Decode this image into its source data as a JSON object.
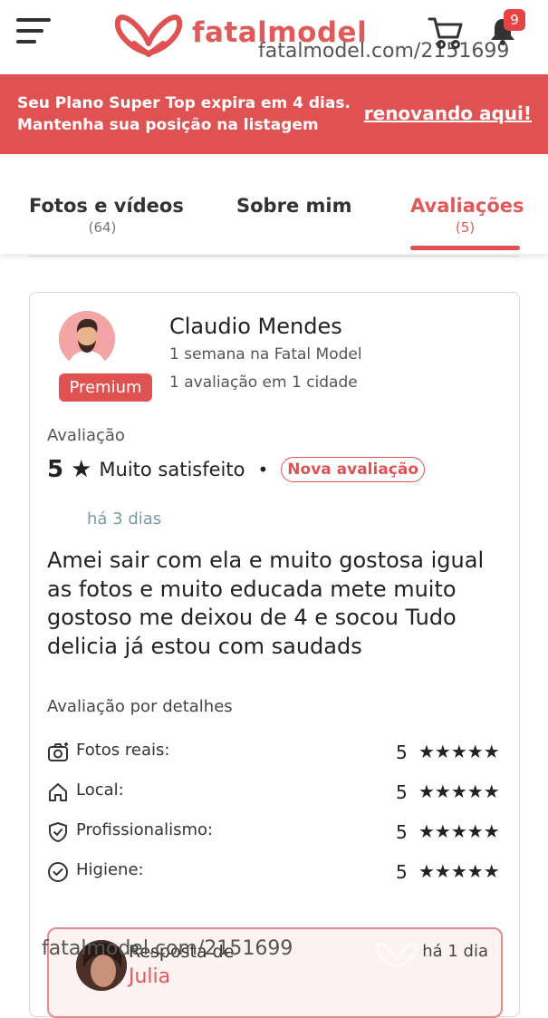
{
  "header": {
    "logo_text": "fatalmodel",
    "watermark": "fatalmodel.com/2151699",
    "notification_count": "9"
  },
  "banner": {
    "line1": "Seu Plano Super Top expira em 4 dias.",
    "line2": "Mantenha sua posição na listagem",
    "link": "renovando aqui!"
  },
  "tabs": [
    {
      "label": "Fotos e vídeos",
      "count": "(64)"
    },
    {
      "label": "Sobre mim",
      "count": ""
    },
    {
      "label": "Avaliações",
      "count": "(5)"
    }
  ],
  "review": {
    "reviewer_name": "Claudio Mendes",
    "reviewer_since": "1 semana na Fatal Model",
    "reviewer_reviews": "1 avaliação em 1 cidade",
    "badge": "Premium",
    "rating_label": "Avaliação",
    "rating_value": "5",
    "rating_text": "Muito satisfeito",
    "new_badge": "Nova avaliação",
    "time_ago": "há 3 dias",
    "text": "Amei sair com ela e muito gostosa igual as fotos e muito educada mete muito gostoso me deixou de 4 e socou Tudo delicia já estou com saudads",
    "details_label": "Avaliação por detalhes",
    "details": [
      {
        "label": "Fotos reais:",
        "score": "5",
        "stars": 5,
        "icon": "camera-icon"
      },
      {
        "label": "Local:",
        "score": "5",
        "stars": 5,
        "icon": "home-icon"
      },
      {
        "label": "Profissionalismo:",
        "score": "5",
        "stars": 5,
        "icon": "shield-check-icon"
      },
      {
        "label": "Higiene:",
        "score": "5",
        "stars": 5,
        "icon": "check-circle-icon"
      }
    ]
  },
  "reply": {
    "title": "Resposta de",
    "time": "há 1 dia",
    "name": "Julia"
  },
  "colors": {
    "brand": "#e05252",
    "accent_text": "#e05a5a"
  }
}
